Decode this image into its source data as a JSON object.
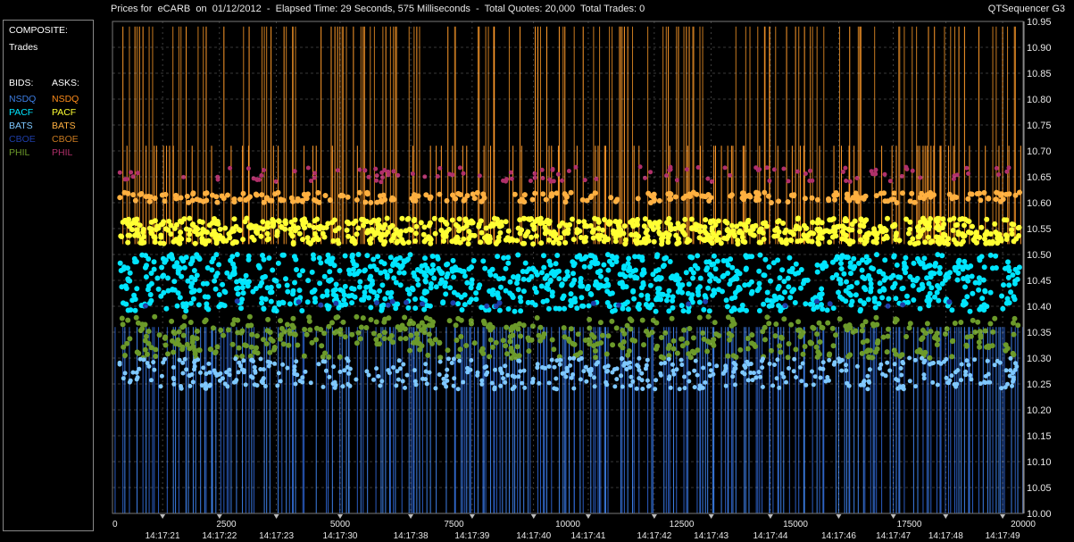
{
  "header": {
    "title": "Prices for  eCARB  on  01/12/2012  -  Elapsed Time: 29 Seconds, 575 Milliseconds  -  Total Quotes: 20,000  Total Trades: 0",
    "app_name": "QTSequencer G3"
  },
  "legend": {
    "composite_label": "COMPOSITE:",
    "trades_label": "Trades",
    "bids_label": "BIDS:",
    "asks_label": "ASKS:",
    "bids": [
      {
        "name": "NSDQ",
        "color": "#3d7fe6"
      },
      {
        "name": "PACF",
        "color": "#00e5ff"
      },
      {
        "name": "BATS",
        "color": "#7ec8ff"
      },
      {
        "name": "CBOE",
        "color": "#1e3ea8"
      },
      {
        "name": "PHIL",
        "color": "#6c9a2a"
      }
    ],
    "asks": [
      {
        "name": "NSDQ",
        "color": "#ff8c1a"
      },
      {
        "name": "PACF",
        "color": "#ffff33"
      },
      {
        "name": "BATS",
        "color": "#ffb040"
      },
      {
        "name": "CBOE",
        "color": "#c87a20"
      },
      {
        "name": "PHIL",
        "color": "#b0306a"
      }
    ]
  },
  "chart_data": {
    "type": "line",
    "x_ticks": [
      "0",
      "2500",
      "5000",
      "7500",
      "10000",
      "12500",
      "15000",
      "17500",
      "20000"
    ],
    "xlim": [
      0,
      20000
    ],
    "ylim": [
      10.0,
      10.95
    ],
    "y_ticks": [
      "10.95",
      "10.90",
      "10.85",
      "10.80",
      "10.75",
      "10.70",
      "10.65",
      "10.60",
      "10.55",
      "10.50",
      "10.45",
      "10.40",
      "10.35",
      "10.30",
      "10.25",
      "10.20",
      "10.15",
      "10.10",
      "10.05",
      "10.00"
    ],
    "time_labels": [
      {
        "x": 1100,
        "label": "14:17:21"
      },
      {
        "x": 2350,
        "label": "14:17:22"
      },
      {
        "x": 3600,
        "label": "14:17:23"
      },
      {
        "x": 5000,
        "label": "14:17:30"
      },
      {
        "x": 6550,
        "label": "14:17:38"
      },
      {
        "x": 7900,
        "label": "14:17:39"
      },
      {
        "x": 9250,
        "label": "14:17:40"
      },
      {
        "x": 10450,
        "label": "14:17:41"
      },
      {
        "x": 11900,
        "label": "14:17:42"
      },
      {
        "x": 13150,
        "label": "14:17:43"
      },
      {
        "x": 14450,
        "label": "14:17:44"
      },
      {
        "x": 15950,
        "label": "14:17:46"
      },
      {
        "x": 17150,
        "label": "14:17:47"
      },
      {
        "x": 18300,
        "label": "14:17:48"
      },
      {
        "x": 19550,
        "label": "14:17:49"
      }
    ],
    "series": [
      {
        "name": "Ask NSDQ",
        "color": "#ff8c1a",
        "typical": 10.58
      },
      {
        "name": "Ask PACF",
        "color": "#ffff33",
        "typical": 10.55
      },
      {
        "name": "Ask BATS",
        "color": "#ffb040",
        "typical": 10.61
      },
      {
        "name": "Ask CBOE",
        "color": "#c87a20",
        "typical": 10.94
      },
      {
        "name": "Ask PHIL",
        "color": "#b0306a",
        "typical": 10.66
      },
      {
        "name": "Bid NSDQ",
        "color": "#3d7fe6",
        "typical": 10.3
      },
      {
        "name": "Bid PACF",
        "color": "#00e5ff",
        "typical": 10.44
      },
      {
        "name": "Bid BATS",
        "color": "#7ec8ff",
        "typical": 10.3
      },
      {
        "name": "Bid CBOE",
        "color": "#1e3ea8",
        "typical": 10.0
      },
      {
        "name": "Bid PHIL",
        "color": "#6c9a2a",
        "typical": 10.34
      }
    ]
  }
}
